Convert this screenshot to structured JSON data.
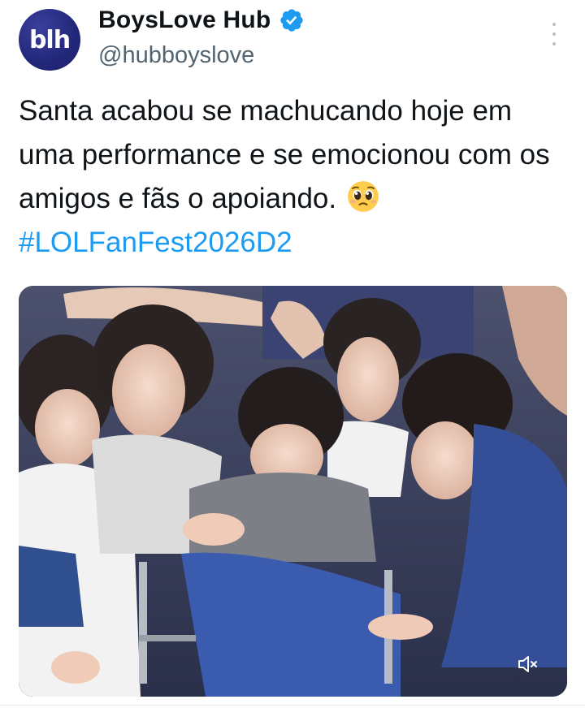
{
  "author": {
    "display_name": "BoysLove Hub",
    "handle": "@hubboyslove",
    "avatar_text": "blh",
    "verified": true
  },
  "tweet": {
    "text_before": "Santa acabou se machucando hoje em uma performance e se emocionou com os amigos e fãs o apoiando.",
    "emoji": "pleading-face-emoji",
    "hashtag": "#LOLFanFest2026D2"
  },
  "media": {
    "type": "video",
    "description_icon": "photo",
    "mute_icon": "speaker-muted-icon"
  },
  "colors": {
    "link": "#1d9bf0",
    "text": "#0f1419",
    "secondary": "#536471",
    "verified": "#1d9bf0"
  }
}
